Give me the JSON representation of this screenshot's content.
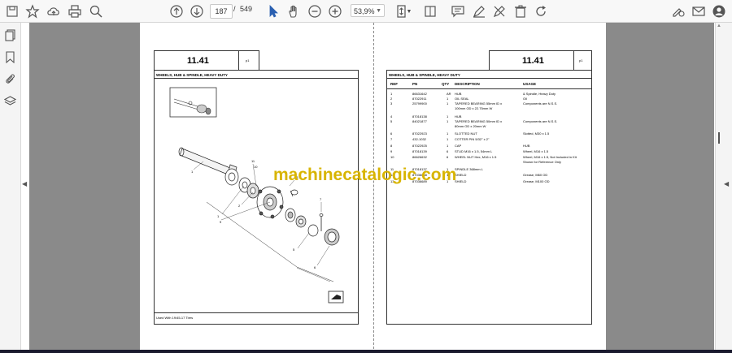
{
  "toolbar": {
    "current_page": "187",
    "page_separator": "/",
    "total_pages": "549",
    "zoom": "53,9%"
  },
  "left_page": {
    "section": "11.41",
    "prefix": "p1",
    "title": "WHEELS, HUB & SPINDLE, HEAVY DUTY",
    "footer": "Used With 19/45-17 Tires"
  },
  "right_page": {
    "section": "11.41",
    "prefix": "p1",
    "title": "WHEELS, HUB & SPINDLE, HEAVY DUTY",
    "columns": [
      "REF",
      "PN",
      "QTY",
      "DESCRIPTION",
      "USAGE"
    ],
    "rows": [
      {
        "ref": "1",
        "pn": "86631642",
        "qty": "AR",
        "desc": "HUB",
        "usage": "& Spindle, Heavy Duty"
      },
      {
        "ref": "2",
        "pn": "87022911",
        "qty": "1",
        "desc": "OIL SEAL",
        "usage": "Oil"
      },
      {
        "ref": "3",
        "pn": "25799900",
        "qty": "1",
        "desc": "TAPERED BEARING 55mm ID x",
        "usage": "Components are N.S.S."
      },
      {
        "ref": "",
        "pn": "",
        "qty": "",
        "desc": "100mm OD x 22.75mm W",
        "usage": ""
      },
      {
        "ref": "4",
        "pn": "87018138",
        "qty": "1",
        "desc": "HUB",
        "usage": ""
      },
      {
        "ref": "5",
        "pn": "84021877",
        "qty": "1",
        "desc": "TAPERED BEARING 50mm ID x",
        "usage": "Components are N.S.S."
      },
      {
        "ref": "",
        "pn": "",
        "qty": "",
        "desc": "80mm OD x 20mm W",
        "usage": ""
      },
      {
        "ref": "6",
        "pn": "87022923",
        "qty": "1",
        "desc": "SLOTTED NUT",
        "usage": "Slotted, M30 x 1.5"
      },
      {
        "ref": "7",
        "pn": "432-1032",
        "qty": "1",
        "desc": "COTTER PIN 5/32\" x 2\"",
        "usage": ""
      },
      {
        "ref": "8",
        "pn": "87022925",
        "qty": "1",
        "desc": "CAP",
        "usage": "HUB"
      },
      {
        "ref": "9",
        "pn": "87018139",
        "qty": "6",
        "desc": "STUD M16 x 1.5, 54mm L",
        "usage": "Wheel, M16 x 1.5"
      },
      {
        "ref": "10",
        "pn": "86626632",
        "qty": "6",
        "desc": "WHEEL NUT Hex, M16 x 1.5",
        "usage": "Wheel, M16 x 1.5, Not Included in Kit"
      },
      {
        "ref": "",
        "pn": "",
        "qty": "",
        "desc": "",
        "usage": "Shown for Reference Only"
      },
      {
        "ref": "11",
        "pn": "87018137",
        "qty": "1",
        "desc": "SPINDLE 368mm L",
        "usage": ""
      },
      {
        "ref": "12",
        "pn": "87036688",
        "qty": "1",
        "desc": "SHIELD",
        "usage": "Grease, M60 OD"
      },
      {
        "ref": "13",
        "pn": "87036689",
        "qty": "1",
        "desc": "SHIELD",
        "usage": "Grease, M100 OD"
      }
    ]
  },
  "watermark": "machinecatalogic.com"
}
